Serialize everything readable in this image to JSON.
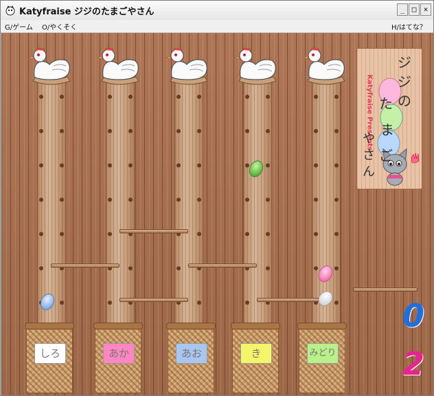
{
  "window": {
    "title": "Katyfraise ジジのたまごやさん",
    "controls": {
      "minimize": "_",
      "maximize": "□",
      "close": "✕"
    }
  },
  "menu": {
    "game": "G/ゲーム",
    "rules": "O/やくそく",
    "help": "H/はてな？"
  },
  "sign": {
    "presents": "Katyfraise Presents",
    "title_chars": [
      "ジ",
      "ジ",
      "の",
      "た",
      "ま",
      "ご",
      "や",
      "さ",
      "ん"
    ]
  },
  "baskets": [
    {
      "label": "しろ",
      "color": "#ffffff"
    },
    {
      "label": "あか",
      "color": "#ff86c2"
    },
    {
      "label": "あお",
      "color": "#a8c6f0"
    },
    {
      "label": "き",
      "color": "#f5f56a"
    },
    {
      "label": "みどり",
      "color": "#b9f08a"
    }
  ],
  "scores": [
    {
      "value": "0",
      "color": "#1f6fe0"
    },
    {
      "value": "2",
      "color": "#e6248f"
    }
  ],
  "eggs": [
    {
      "color": "blue"
    },
    {
      "color": "green"
    },
    {
      "color": "pink"
    },
    {
      "color": "white"
    }
  ],
  "colors": {
    "wood": "#a86f4e",
    "sign": "#e8c3a6"
  }
}
